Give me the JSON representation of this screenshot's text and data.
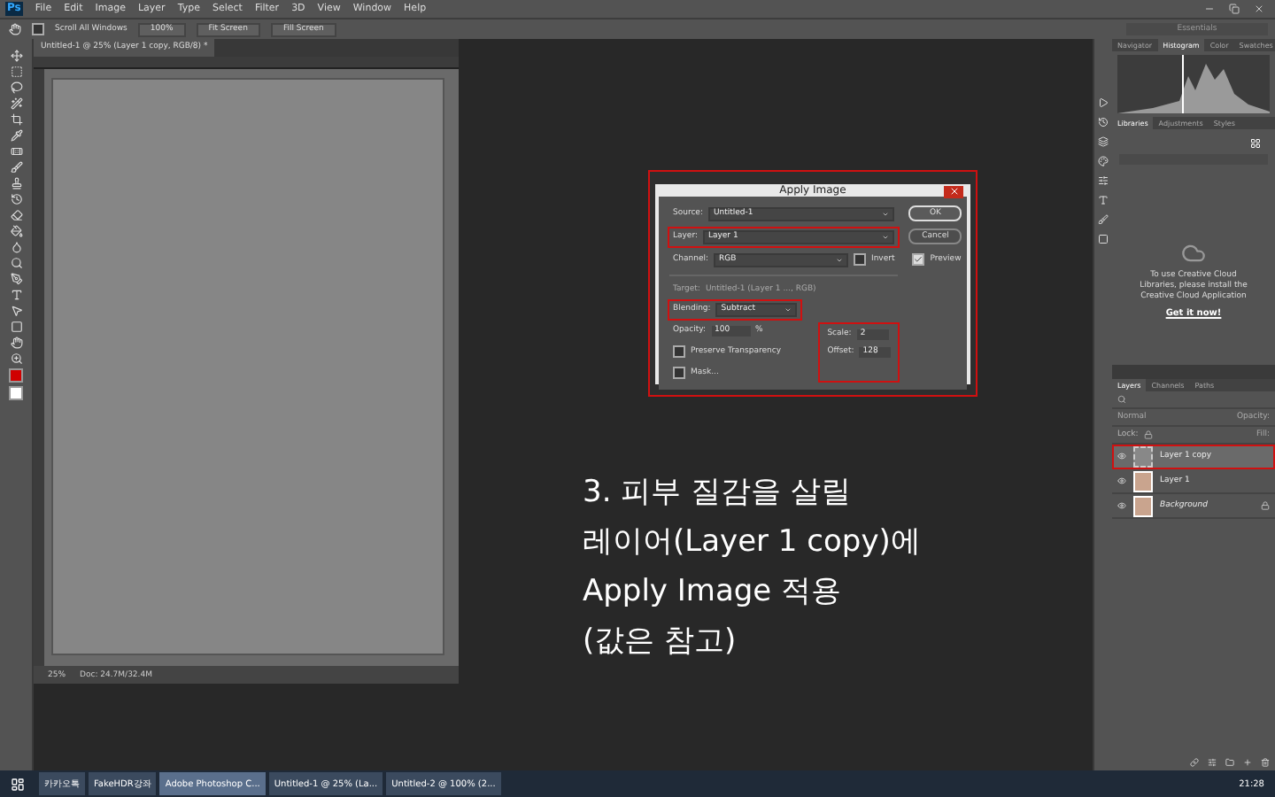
{
  "app": {
    "logo": "Ps"
  },
  "menu": [
    "File",
    "Edit",
    "Image",
    "Layer",
    "Type",
    "Select",
    "Filter",
    "3D",
    "View",
    "Window",
    "Help"
  ],
  "options_bar": {
    "scroll_all": {
      "label": "Scroll All Windows",
      "checked": false
    },
    "buttons": [
      "100%",
      "Fit Screen",
      "Fill Screen"
    ],
    "workspace": "Essentials"
  },
  "document": {
    "tab_title": "Untitled-1 @ 25% (Layer 1 copy, RGB/8) *",
    "zoom": "25%",
    "doc_info": "Doc: 24.7M/32.4M"
  },
  "dialog": {
    "title": "Apply Image",
    "marked": true,
    "source": {
      "label": "Source:",
      "value": "Untitled-1"
    },
    "layer": {
      "label": "Layer:",
      "value": "Layer 1",
      "marked": true
    },
    "channel": {
      "label": "Channel:",
      "value": "RGB"
    },
    "invert": {
      "label": "Invert",
      "checked": false
    },
    "target": {
      "label": "Target:",
      "value": "Untitled-1 (Layer 1 ..., RGB)"
    },
    "blending": {
      "label": "Blending:",
      "value": "Subtract",
      "marked": true
    },
    "opacity": {
      "label": "Opacity:",
      "value": "100",
      "unit": "%"
    },
    "preserve": {
      "label": "Preserve Transparency",
      "checked": false
    },
    "mask": {
      "label": "Mask...",
      "checked": false
    },
    "scale": {
      "label": "Scale:",
      "value": "2"
    },
    "offset": {
      "label": "Offset:",
      "value": "128"
    },
    "scale_offset_marked": true,
    "buttons": [
      "OK",
      "Cancel"
    ],
    "preview": {
      "label": "Preview",
      "checked": true
    }
  },
  "panels": {
    "top_tabs": [
      {
        "label": "Navigator",
        "selected": false
      },
      {
        "label": "Histogram",
        "selected": true
      },
      {
        "label": "Color",
        "selected": false
      },
      {
        "label": "Swatches",
        "selected": false
      }
    ],
    "lib_tabs": [
      {
        "label": "Libraries",
        "selected": true
      },
      {
        "label": "Adjustments",
        "selected": false
      },
      {
        "label": "Styles",
        "selected": false
      }
    ],
    "lib_message": "To use Creative Cloud Libraries, please install the Creative Cloud Application",
    "lib_link": "Get it now!"
  },
  "layers_panel": {
    "tabs": [
      {
        "label": "Layers",
        "selected": true
      },
      {
        "label": "Channels",
        "selected": false
      },
      {
        "label": "Paths",
        "selected": false
      }
    ],
    "blend_mode": "Normal",
    "opacity_label": "Opacity:",
    "lock_label": "Lock:",
    "fill_label": "Fill:",
    "layers": [
      {
        "name": "Layer 1 copy",
        "selected": true,
        "marked": true,
        "visible": true,
        "kind": "blank",
        "locked": false,
        "italic": false
      },
      {
        "name": "Layer 1",
        "selected": false,
        "marked": false,
        "visible": true,
        "kind": "photo",
        "locked": false,
        "italic": false
      },
      {
        "name": "Background",
        "selected": false,
        "marked": false,
        "visible": true,
        "kind": "photo",
        "locked": true,
        "italic": true
      }
    ]
  },
  "annotation": [
    "3. 피부 질감을 살릴",
    "레이어(Layer 1 copy)에",
    "Apply Image 적용",
    "(값은 참고)"
  ],
  "taskbar": {
    "items": [
      {
        "label": "카카오톡",
        "selected": false
      },
      {
        "label": "FakeHDR강좌",
        "selected": false
      },
      {
        "label": "Adobe Photoshop C...",
        "selected": true
      },
      {
        "label": "Untitled-1 @ 25% (La...",
        "selected": false
      },
      {
        "label": "Untitled-2 @ 100% (2...",
        "selected": false
      }
    ],
    "clock": "21:28"
  }
}
